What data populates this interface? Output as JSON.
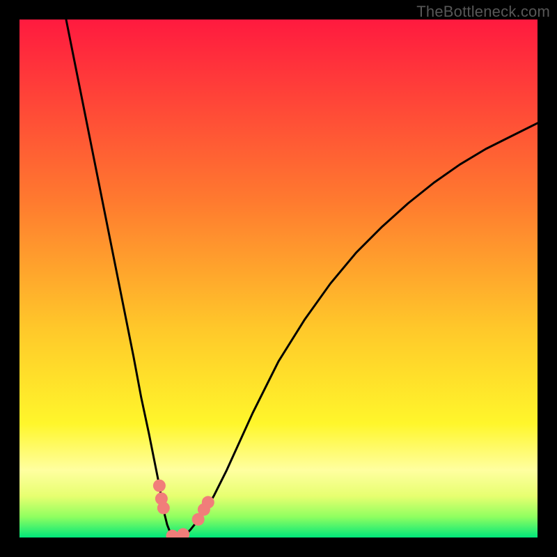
{
  "attribution": "TheBottleneck.com",
  "colors": {
    "black": "#000000",
    "red_top": "#ff1a3f",
    "orange_mid": "#ff9a2a",
    "yellow": "#fff62b",
    "pale_yellow": "#ffffa0",
    "lime": "#b8ff4a",
    "green_bottom": "#00e77a",
    "curve": "#000000",
    "marker": "#f17d7a",
    "attribution_text": "#575757"
  },
  "chart_data": {
    "type": "line",
    "title": "",
    "xlabel": "",
    "ylabel": "",
    "xlim": [
      0,
      100
    ],
    "ylim": [
      0,
      100
    ],
    "grid": false,
    "legend": false,
    "series": [
      {
        "name": "bottleneck-curve",
        "x": [
          9,
          10,
          12,
          14,
          16,
          18,
          20,
          22,
          23.5,
          25,
          26,
          27,
          27.5,
          28,
          28.5,
          29,
          29.5,
          30,
          31,
          32,
          33,
          35,
          37.5,
          40,
          45,
          50,
          55,
          60,
          65,
          70,
          75,
          80,
          85,
          90,
          95,
          100
        ],
        "y": [
          100,
          95,
          85,
          75,
          65,
          55,
          45,
          35,
          27,
          20,
          15,
          10,
          7,
          4.5,
          2.5,
          1.2,
          0.4,
          0,
          0,
          0.5,
          1.5,
          4,
          8,
          13,
          24,
          34,
          42,
          49,
          55,
          60,
          64.5,
          68.5,
          72,
          75,
          77.5,
          80
        ]
      }
    ],
    "markers": [
      {
        "name": "point-a",
        "x": 27.0,
        "y": 10.0
      },
      {
        "name": "point-b",
        "x": 27.4,
        "y": 7.5
      },
      {
        "name": "point-c",
        "x": 27.8,
        "y": 5.7
      },
      {
        "name": "point-d",
        "x": 31.6,
        "y": 0.6
      },
      {
        "name": "point-e",
        "x": 29.5,
        "y": 0.3
      },
      {
        "name": "point-f",
        "x": 34.5,
        "y": 3.5
      },
      {
        "name": "point-g",
        "x": 35.6,
        "y": 5.4
      },
      {
        "name": "point-h",
        "x": 36.4,
        "y": 6.8
      }
    ],
    "minimum_x": 30,
    "gradient_meaning": "red=worst, green=best"
  }
}
